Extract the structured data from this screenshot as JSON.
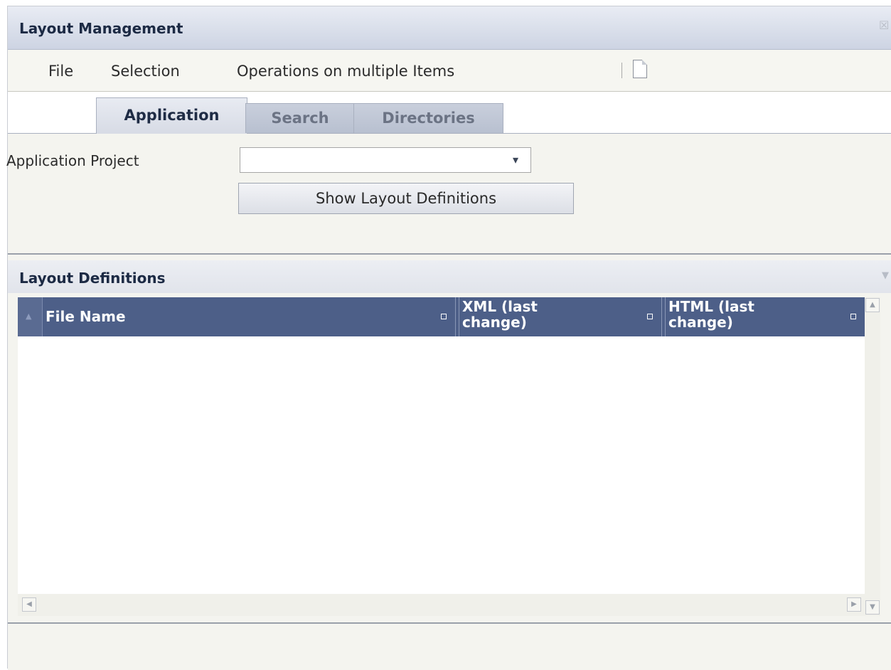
{
  "window": {
    "title": "Layout Management"
  },
  "menu": {
    "items": [
      "File",
      "Selection",
      "Operations on multiple Items"
    ]
  },
  "tabs": [
    {
      "label": "Application",
      "active": true
    },
    {
      "label": "Search",
      "active": false
    },
    {
      "label": "Directories",
      "active": false
    }
  ],
  "form": {
    "project_label": "Application Project",
    "project_value": "",
    "show_button": "Show Layout Definitions"
  },
  "panel": {
    "title": "Layout Definitions",
    "columns": [
      {
        "line1": "File Name",
        "line2": ""
      },
      {
        "line1": "XML (last",
        "line2": "change)"
      },
      {
        "line1": "HTML (last",
        "line2": "change)"
      }
    ],
    "rows": []
  },
  "icons": {
    "close": "close-icon",
    "new_document": "new-document-icon",
    "dropdown": "chevron-down-icon",
    "collapse": "collapse-icon"
  },
  "colors": {
    "grid_header": "#4d5f88",
    "title_text": "#1c2a44",
    "frame_bg": "#f4f4ef"
  }
}
